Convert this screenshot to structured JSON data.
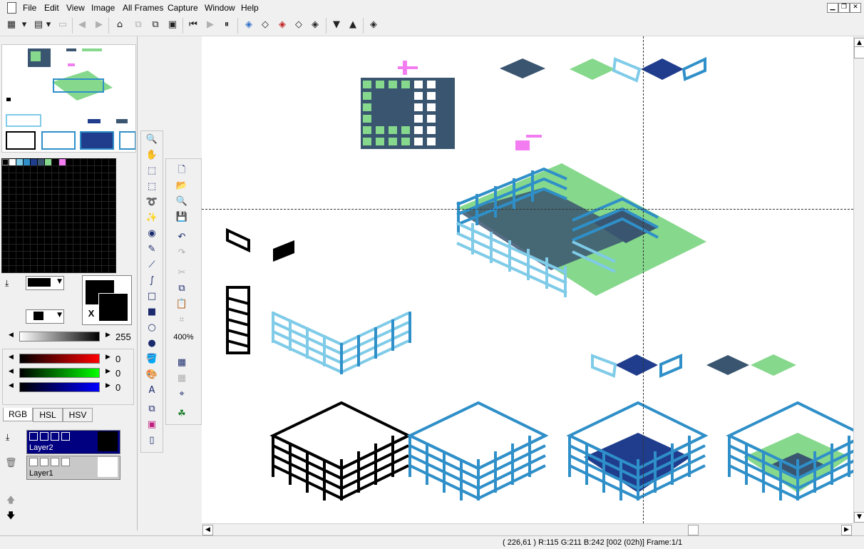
{
  "menubar": {
    "items": [
      {
        "label": "File",
        "underline": "F"
      },
      {
        "label": "Edit",
        "underline": "E"
      },
      {
        "label": "View",
        "underline": "V"
      },
      {
        "label": "Image",
        "underline": "I"
      },
      {
        "label": "All Frames",
        "underline": "A"
      },
      {
        "label": "Capture",
        "underline": "C"
      },
      {
        "label": "Window",
        "underline": "W"
      },
      {
        "label": "Help",
        "underline": "H"
      }
    ]
  },
  "window_controls": {
    "minimize": "▁",
    "restore": "❐",
    "close": "✕"
  },
  "colors": {
    "dark_blue": "#3a5570",
    "navy": "#1f3d8c",
    "light_blue": "#7fcbe8",
    "mid_blue": "#2f8fc8",
    "green": "#86d88c",
    "pink": "#f27cf0",
    "selected_layer": "#000080"
  },
  "palette_top_row": [
    "#ffffff",
    "#7fcbe8",
    "#2f8fc8",
    "#1f3d8c",
    "#3a5570",
    "#86d88c",
    "#000000",
    "#f27cf0"
  ],
  "color_picker": {
    "gray_value": "255",
    "r_value": "0",
    "g_value": "0",
    "b_value": "0",
    "swap_label": "X"
  },
  "zoom": {
    "label": "400%"
  },
  "tabs": [
    "RGB",
    "HSL",
    "HSV"
  ],
  "layers": [
    {
      "name": "Layer2",
      "selected": true
    },
    {
      "name": "Layer1",
      "selected": false
    }
  ],
  "status": {
    "text": "( 226,61 ) R:115 G:211 B:242  [002 (02h)]  Frame:1/1"
  }
}
